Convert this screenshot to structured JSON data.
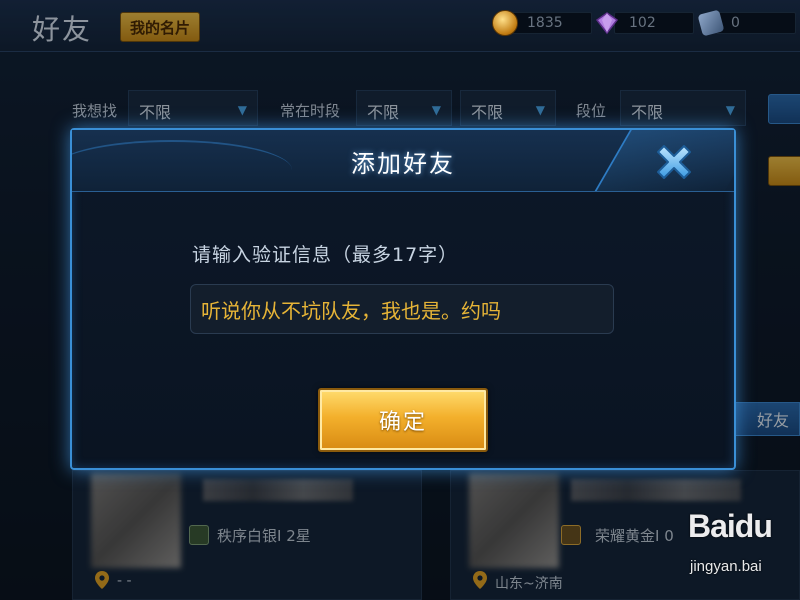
{
  "header": {
    "title": "好友",
    "card_button": "我的名片",
    "currency": [
      {
        "icon": "coin-icon",
        "value": "1835"
      },
      {
        "icon": "gem-icon",
        "value": "102"
      },
      {
        "icon": "voucher-icon",
        "value": "0"
      }
    ]
  },
  "filters": {
    "looking_for_label": "我想找",
    "looking_for_value": "不限",
    "online_time_label": "常在时段",
    "online_time_value": "不限",
    "online_time_value_2": "不限",
    "rank_label": "段位",
    "rank_value": "不限"
  },
  "background_button": {
    "add_friend_partial": "好友"
  },
  "friends": [
    {
      "rank": "秩序白银I 2星",
      "location": "- -"
    },
    {
      "rank": "荣耀黄金I 0",
      "location": "山东~济南"
    }
  ],
  "dialog": {
    "title": "添加好友",
    "prompt": "请输入验证信息（最多17字）",
    "input_value": "听说你从不坑队友，我也是。约吗",
    "confirm_label": "确定",
    "close_icon": "close-icon"
  },
  "watermark": {
    "logo": "Baidu",
    "sub": "jingyan.bai"
  },
  "colors": {
    "dialog_border": "#3a8fd6",
    "input_text": "#e6b437",
    "confirm_gold": "#f3b02c"
  }
}
